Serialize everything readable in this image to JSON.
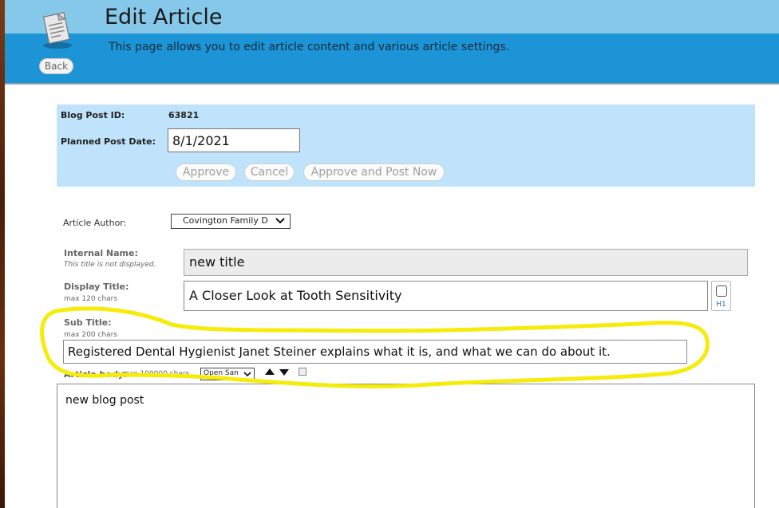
{
  "header": {
    "title": "Edit Article",
    "description": "This page allows you to edit article content and various article settings.",
    "back_label": "Back",
    "icon": "document-icon"
  },
  "id_panel": {
    "post_id_label": "Blog Post ID:",
    "post_id_value": "63821",
    "date_label": "Planned Post Date:",
    "date_value": "8/1/2021",
    "approve_label": "Approve",
    "cancel_label": "Cancel",
    "approve_post_label": "Approve and Post Now"
  },
  "form": {
    "author_label": "Article Author:",
    "author_value": "Covington Family D",
    "internal_name_label": "Internal Name:",
    "internal_name_note": "This title is not displayed.",
    "internal_name_value": "new title",
    "display_title_label": "Display Title:",
    "display_title_note": "max 120 chars",
    "display_title_value": "A Closer Look at Tooth Sensitivity",
    "h1_label": "H1",
    "subtitle_label": "Sub Title:",
    "subtitle_note": "max 200 chars",
    "subtitle_value": "Registered Dental Hygienist Janet Steiner explains what it is, and what we can do about it.",
    "body_label": "Article body:",
    "body_note": "max 100000 chars",
    "font_value": "Open San",
    "body_value": "new blog post"
  },
  "colors": {
    "header_light": "#86c8e9",
    "header_dark": "#1d94d6",
    "panel": "#bfe3fb",
    "highlight": "#f5ec0a"
  }
}
